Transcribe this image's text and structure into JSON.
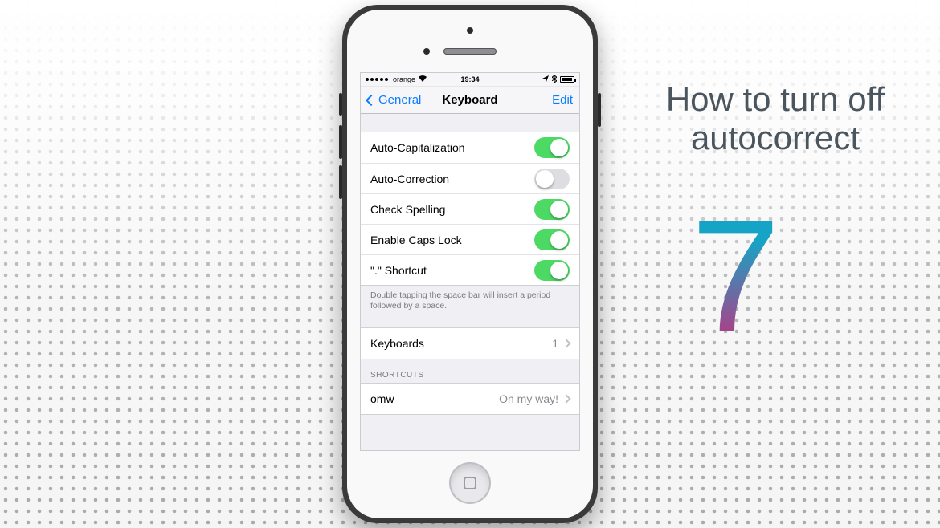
{
  "status": {
    "carrier": "orange",
    "time": "19:34"
  },
  "nav": {
    "back_label": "General",
    "title": "Keyboard",
    "edit_label": "Edit"
  },
  "toggles": [
    {
      "label": "Auto-Capitalization",
      "on": true
    },
    {
      "label": "Auto-Correction",
      "on": false
    },
    {
      "label": "Check Spelling",
      "on": true
    },
    {
      "label": "Enable Caps Lock",
      "on": true
    },
    {
      "label": "\".\" Shortcut",
      "on": true
    }
  ],
  "footer_note": "Double tapping the space bar will insert a period followed by a space.",
  "keyboards": {
    "label": "Keyboards",
    "count": "1"
  },
  "shortcuts_header": "SHORTCUTS",
  "shortcuts": [
    {
      "key": "omw",
      "value": "On my way!"
    }
  ],
  "promo": {
    "line1": "How to turn off",
    "line2": "autocorrect",
    "seven": "7"
  }
}
